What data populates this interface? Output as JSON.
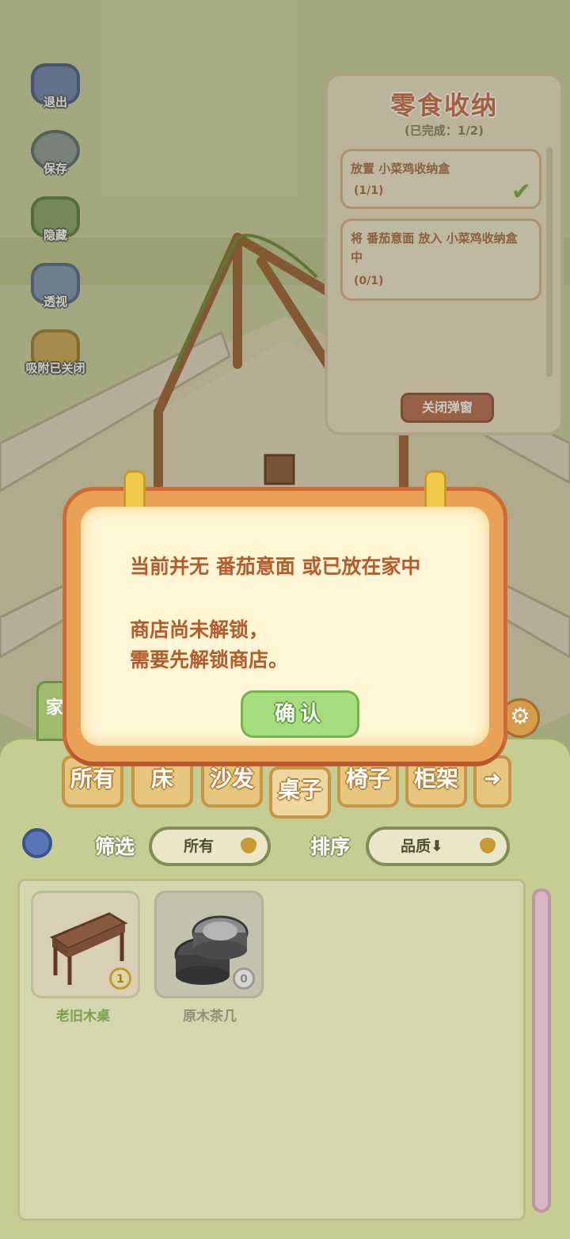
{
  "left_tools": [
    {
      "label": "退出",
      "icon": "exit-icon"
    },
    {
      "label": "保存",
      "icon": "save-icon"
    },
    {
      "label": "隐藏",
      "icon": "hide-icon"
    },
    {
      "label": "透视",
      "icon": "perspective-icon"
    },
    {
      "label": "吸附已关闭",
      "icon": "snap-icon"
    }
  ],
  "task_panel": {
    "title": "零食收纳",
    "progress": "(已完成：1/2)",
    "tasks": [
      {
        "text": "放置 小菜鸡收纳盒",
        "count": "(1/1)",
        "done": true
      },
      {
        "text": "将 番茄意面 放入 小菜鸡收纳盒中",
        "count": "(0/1)",
        "done": false
      }
    ],
    "close_label": "关闭弹窗"
  },
  "dialog": {
    "line1": "当前并无 番茄意面 或已放在家中",
    "line2": "商店尚未解锁，",
    "line3": "需要先解锁商店。",
    "confirm_label": "确认"
  },
  "inventory": {
    "side_tab_label": "家",
    "categories": [
      "所有",
      "床",
      "沙发",
      "桌子",
      "椅子",
      "柜架"
    ],
    "active_category": "桌子",
    "filter_label": "筛选",
    "filter_value": "所有",
    "sort_label": "排序",
    "sort_value": "品质⬇",
    "items": [
      {
        "name": "老旧木桌",
        "qty": "1",
        "owned": true
      },
      {
        "name": "原木茶几",
        "qty": "0",
        "owned": false
      }
    ]
  },
  "colors": {
    "dialog_text": "#b55b2c",
    "confirm_button": "#a6dd7d",
    "task_title": "#c96c4b"
  }
}
